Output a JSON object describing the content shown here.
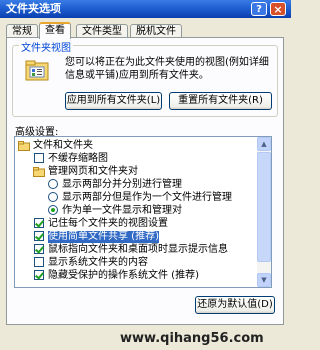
{
  "window": {
    "title": "文件夹选项",
    "help_label": "?",
    "close_label": "×"
  },
  "tabs": [
    "常规",
    "查看",
    "文件类型",
    "脱机文件"
  ],
  "folder_views": {
    "legend": "文件夹视图",
    "description": "您可以将正在为此文件夹使用的视图(例如详细信息或平铺)应用到所有文件夹。",
    "apply_button": "应用到所有文件夹(L)",
    "reset_button": "重置所有文件夹(R)"
  },
  "advanced": {
    "label": "高级设置:",
    "items": [
      {
        "text": "文件和文件夹",
        "kind": "folder",
        "checked": false,
        "level": 0
      },
      {
        "text": "不缓存缩略图",
        "kind": "checkbox",
        "checked": false,
        "level": 1
      },
      {
        "text": "管理网页和文件夹对",
        "kind": "folder",
        "checked": false,
        "level": 1
      },
      {
        "text": "显示两部分并分别进行管理",
        "kind": "radio",
        "checked": false,
        "level": 2
      },
      {
        "text": "显示两部分但是作为一个文件进行管理",
        "kind": "radio",
        "checked": false,
        "level": 2
      },
      {
        "text": "作为单一文件显示和管理对",
        "kind": "radio",
        "checked": true,
        "level": 2
      },
      {
        "text": "记住每个文件夹的视图设置",
        "kind": "checkbox",
        "checked": true,
        "level": 1
      },
      {
        "text": "使用简单文件共享 (推荐)",
        "kind": "checkbox",
        "checked": true,
        "level": 1,
        "selected": true
      },
      {
        "text": "鼠标指向文件夹和桌面项时显示提示信息",
        "kind": "checkbox",
        "checked": true,
        "level": 1
      },
      {
        "text": "显示系统文件夹的内容",
        "kind": "checkbox",
        "checked": false,
        "level": 1
      },
      {
        "text": "隐藏受保护的操作系统文件 (推荐)",
        "kind": "checkbox",
        "checked": true,
        "level": 1
      }
    ]
  },
  "restore_button": "还原为默认值(D)",
  "watermark": "www.qihang56.com",
  "colors": {
    "accent": "#316ac5",
    "titlebar": "#0a3fb0",
    "legend": "#0046d5"
  }
}
